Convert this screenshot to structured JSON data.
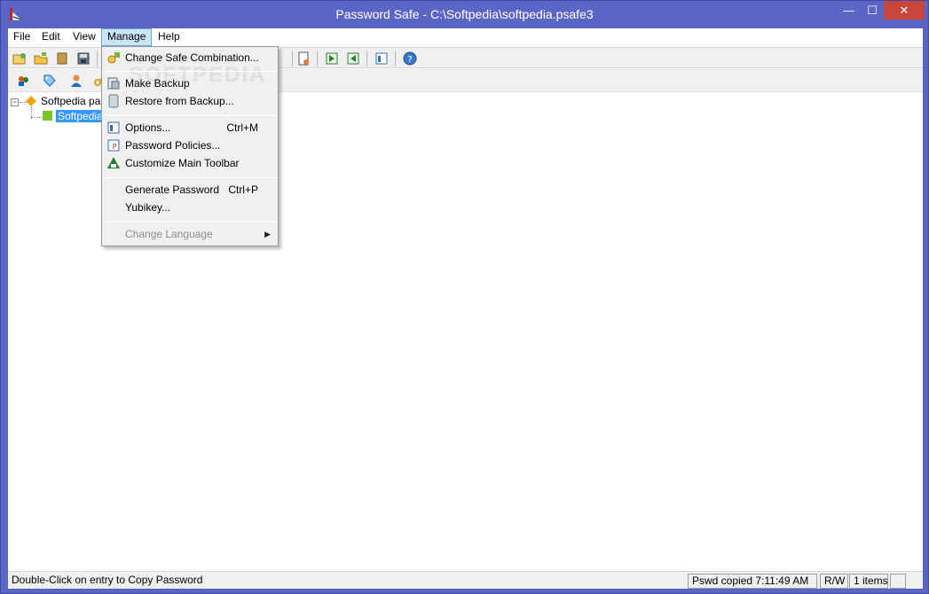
{
  "window": {
    "title": "Password Safe - C:\\Softpedia\\softpedia.psafe3",
    "minimize_glyph": "—",
    "maximize_glyph": "☐",
    "close_glyph": "✕"
  },
  "menubar": {
    "items": [
      {
        "label": "File"
      },
      {
        "label": "Edit"
      },
      {
        "label": "View"
      },
      {
        "label": "Manage"
      },
      {
        "label": "Help"
      }
    ]
  },
  "toolbar": {
    "icons": [
      "new-safe-icon",
      "open-safe-icon",
      "close-safe-icon",
      "save-icon",
      "properties-icon",
      "import-icon",
      "export-icon",
      "database-icon",
      "help-icon"
    ]
  },
  "toolbar2": {
    "icons": [
      "add-group-icon",
      "tag-icon",
      "user-icon",
      "key-icon"
    ]
  },
  "tree": {
    "root_label": "Softpedia pa",
    "child_label": "Softpedia"
  },
  "manage_menu": {
    "items": [
      {
        "label": "Change Safe Combination...",
        "shortcut": "",
        "icon": "key-lock-icon",
        "disabled": false
      },
      {
        "label": "Make Backup",
        "shortcut": "",
        "icon": "backup-icon",
        "disabled": false
      },
      {
        "label": "Restore from Backup...",
        "shortcut": "",
        "icon": "restore-icon",
        "disabled": false
      },
      {
        "label": "Options...",
        "shortcut": "Ctrl+M",
        "icon": "options-icon",
        "disabled": false
      },
      {
        "label": "Password Policies...",
        "shortcut": "",
        "icon": "policy-icon",
        "disabled": false
      },
      {
        "label": "Customize Main Toolbar",
        "shortcut": "",
        "icon": "toolbar-customize-icon",
        "disabled": false
      },
      {
        "label": "Generate Password",
        "shortcut": "Ctrl+P",
        "icon": "",
        "disabled": false
      },
      {
        "label": "Yubikey...",
        "shortcut": "",
        "icon": "",
        "disabled": false
      },
      {
        "label": "Change Language",
        "shortcut": "",
        "icon": "",
        "disabled": true
      }
    ],
    "watermark": "SOFTPEDIA"
  },
  "statusbar": {
    "hint": "Double-Click on entry to Copy Password",
    "copied": "Pswd copied 7:11:49 AM",
    "mode": "R/W",
    "count": "1 items"
  },
  "colors": {
    "title_bar": "#5b65c5",
    "close_button": "#c7453a",
    "menu_highlight": "#cce4f7",
    "selection": "#3399ff"
  }
}
